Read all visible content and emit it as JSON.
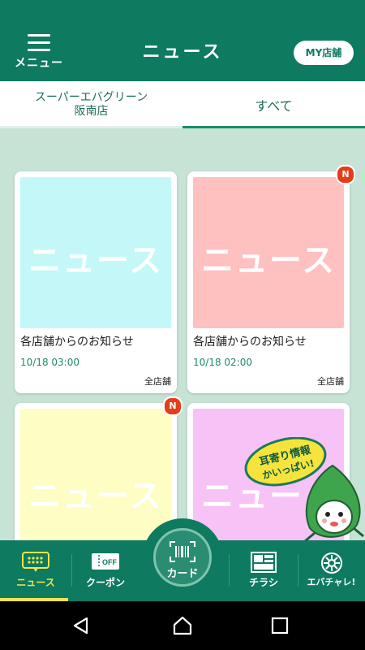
{
  "header": {
    "menu_label": "メニュー",
    "title": "ニュース",
    "my_store_label": "MY店舗"
  },
  "tabs": [
    {
      "label": "スーパーエバグリーン 阪南店",
      "selected": false
    },
    {
      "label": "すべて",
      "selected": true
    }
  ],
  "cards": [
    {
      "thumb_text": "ニュース",
      "thumb_color": "#c4f8f8",
      "title": "各店舗からのお知らせ",
      "date": "10/18 03:00",
      "store": "全店舗",
      "new_badge": ""
    },
    {
      "thumb_text": "ニュース",
      "thumb_color": "#ffc0c0",
      "title": "各店舗からのお知らせ",
      "date": "10/18 02:00",
      "store": "全店舗",
      "new_badge": "N"
    },
    {
      "thumb_text": "ニュース",
      "thumb_color": "#fdfdc4",
      "new_badge": "N"
    },
    {
      "thumb_text": "ニュー",
      "thumb_color": "#f7c2f6",
      "new_badge": ""
    }
  ],
  "mascot": {
    "bubble_line1": "耳寄り情報",
    "bubble_line2": "かいっぱい!"
  },
  "bottom_nav": [
    {
      "label": "ニュース",
      "icon": "chat-icon",
      "active": true
    },
    {
      "label": "クーポン",
      "icon": "coupon-icon",
      "active": false
    },
    {
      "label": "カード",
      "icon": "barcode-icon",
      "active": false
    },
    {
      "label": "チラシ",
      "icon": "flyer-icon",
      "active": false
    },
    {
      "label": "エバチャレ!",
      "icon": "challenge-icon",
      "active": false
    }
  ],
  "coupon_icon_text": "OFF",
  "colors": {
    "primary": "#0e7a5f",
    "background": "#c7e3d6",
    "active_indicator": "#f1e54a",
    "badge": "#e53d1a"
  }
}
